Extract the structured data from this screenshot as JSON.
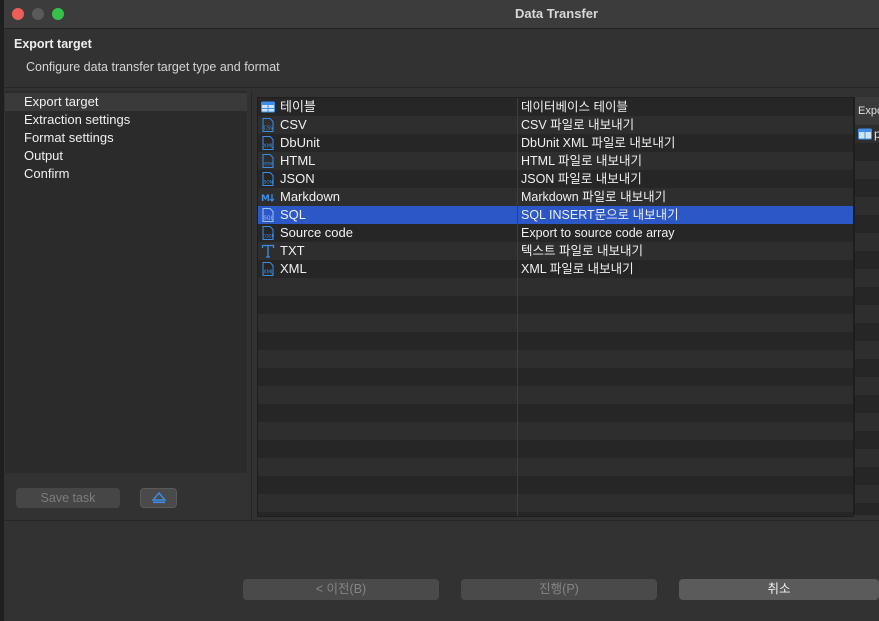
{
  "window": {
    "title": "Data Transfer"
  },
  "header": {
    "title": "Export target",
    "description": "Configure data transfer target type and format"
  },
  "nav": {
    "items": [
      {
        "label": "Export target",
        "active": true
      },
      {
        "label": "Extraction settings",
        "active": false
      },
      {
        "label": "Format settings",
        "active": false
      },
      {
        "label": "Output",
        "active": false
      },
      {
        "label": "Confirm",
        "active": false
      }
    ]
  },
  "task_buttons": {
    "save_task": "Save task",
    "upload_icon": "upload-tray-icon"
  },
  "formats": [
    {
      "name": "테이블",
      "description": "데이터베이스 테이블",
      "icon": "table-icon",
      "selected": false
    },
    {
      "name": "CSV",
      "description": "CSV 파일로 내보내기",
      "icon": "csv-file-icon",
      "selected": false
    },
    {
      "name": "DbUnit",
      "description": "DbUnit XML 파일로 내보내기",
      "icon": "xml-file-icon",
      "selected": false
    },
    {
      "name": "HTML",
      "description": "HTML 파일로 내보내기",
      "icon": "html-file-icon",
      "selected": false
    },
    {
      "name": "JSON",
      "description": "JSON 파일로 내보내기",
      "icon": "json-file-icon",
      "selected": false
    },
    {
      "name": "Markdown",
      "description": "Markdown 파일로 내보내기",
      "icon": "markdown-icon",
      "selected": false
    },
    {
      "name": "SQL",
      "description": "SQL INSERT문으로 내보내기",
      "icon": "sql-file-icon",
      "selected": true
    },
    {
      "name": "Source code",
      "description": "Export to source code array",
      "icon": "code-file-icon",
      "selected": false
    },
    {
      "name": "TXT",
      "description": "텍스트 파일로 내보내기",
      "icon": "text-icon",
      "selected": false
    },
    {
      "name": "XML",
      "description": "XML 파일로 내보내기",
      "icon": "xml-file-icon",
      "selected": false
    }
  ],
  "right_panel": {
    "header": "Expo",
    "first_row_icon": "table-icon",
    "first_row_text": "p"
  },
  "footer": {
    "back": "< 이전(B)",
    "next": "진행(P)",
    "cancel": "취소"
  },
  "colors": {
    "selection": "#2b58c6",
    "icon_blue": "#3d8ee8",
    "close": "#ee5d56",
    "maximize": "#35c14a"
  }
}
